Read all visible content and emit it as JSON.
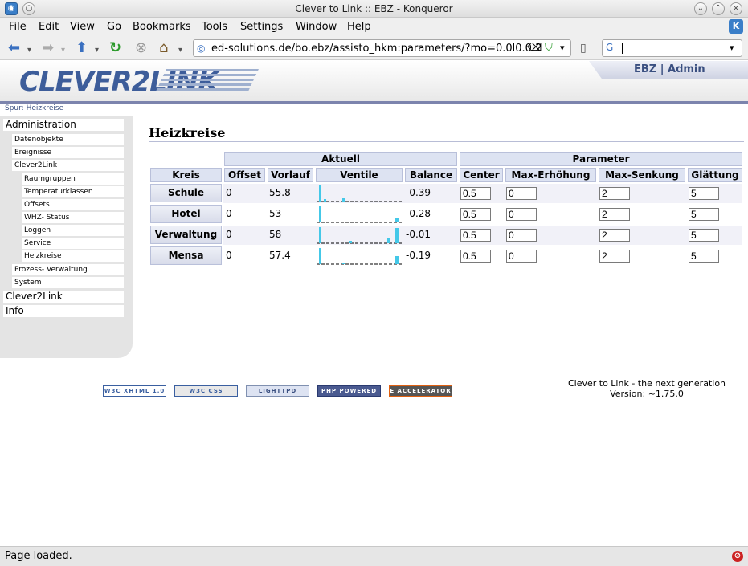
{
  "window": {
    "title": "Clever to Link :: EBZ - Konqueror"
  },
  "menubar": [
    "File",
    "Edit",
    "View",
    "Go",
    "Bookmarks",
    "Tools",
    "Settings",
    "Window",
    "Help"
  ],
  "toolbar": {
    "url": "ed-solutions.de/bo.ebz/assisto_hkm:parameters/?mo=0.0l0.0.2",
    "search_value": ""
  },
  "header": {
    "logo": "CLEVER2LINK",
    "user": "EBZ | Admin"
  },
  "breadcrumb": {
    "prefix": "Spur:",
    "current": "Heizkreise"
  },
  "sidebar": {
    "l1": [
      "Administration",
      "Clever2Link",
      "Info"
    ],
    "admin_items": [
      "Datenobjekte",
      "Ereignisse",
      "Clever2Link"
    ],
    "c2l_items": [
      "Raumgruppen",
      "Temperaturklassen",
      "Offsets",
      "WHZ- Status",
      "Loggen",
      "Service",
      "Heizkreise"
    ],
    "admin_tail": [
      "Prozess- Verwaltung",
      "System"
    ]
  },
  "content": {
    "title": "Heizkreise",
    "group_headers": {
      "aktuell": "Aktuell",
      "parameter": "Parameter"
    },
    "columns": [
      "Kreis",
      "Offset",
      "Vorlauf",
      "Ventile",
      "Balance",
      "Center",
      "Max-Erhöhung",
      "Max-Senkung",
      "Glättung"
    ],
    "rows": [
      {
        "kreis": "Schule",
        "offset": "0",
        "vorlauf": "55.8",
        "balance": "-0.39",
        "center": "0.5",
        "max_erh": "0",
        "max_senk": "2",
        "glaettung": "5"
      },
      {
        "kreis": "Hotel",
        "offset": "0",
        "vorlauf": "53",
        "balance": "-0.28",
        "center": "0.5",
        "max_erh": "0",
        "max_senk": "2",
        "glaettung": "5"
      },
      {
        "kreis": "Verwaltung",
        "offset": "0",
        "vorlauf": "58",
        "balance": "-0.01",
        "center": "0.5",
        "max_erh": "0",
        "max_senk": "2",
        "glaettung": "5"
      },
      {
        "kreis": "Mensa",
        "offset": "0",
        "vorlauf": "57.4",
        "balance": "-0.19",
        "center": "0.5",
        "max_erh": "0",
        "max_senk": "2",
        "glaettung": "5"
      }
    ]
  },
  "footer": {
    "badges": [
      "W3C XHTML 1.0",
      "W3C CSS",
      "LIGHTTPD",
      "PHP POWERED",
      "E ACCELERATOR"
    ],
    "line1": "Clever to Link - the next generation",
    "line2": "Version: ~1.75.0"
  },
  "status": {
    "text": "Page loaded."
  },
  "colors": {
    "accent": "#3d5d9a",
    "header_bg": "#dde3f2",
    "rule": "#7c84ad",
    "spark": "#44c8e8"
  }
}
